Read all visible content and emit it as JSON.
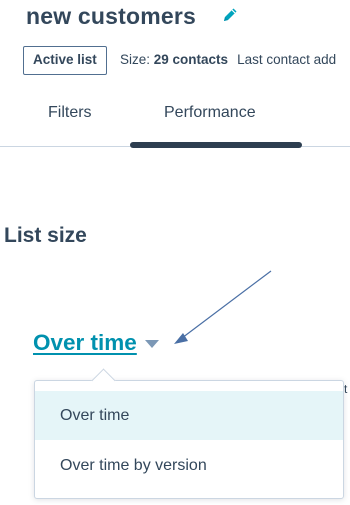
{
  "header": {
    "title": "new customers",
    "edit_icon": "pencil-icon"
  },
  "meta": {
    "status_badge": "Active list",
    "size_label": "Size:",
    "size_value": "29 contacts",
    "last_contact_label": "Last contact add"
  },
  "tabs": [
    {
      "label": "Filters",
      "active": false
    },
    {
      "label": "Performance",
      "active": true
    }
  ],
  "section": {
    "heading": "List size"
  },
  "range_select": {
    "selected": "Over time",
    "caret_icon": "caret-down-icon"
  },
  "dropdown": {
    "options": [
      {
        "label": "Over time",
        "highlighted": true
      },
      {
        "label": "Over time by version",
        "highlighted": false
      }
    ]
  },
  "edge_text": "t",
  "colors": {
    "text": "#33475b",
    "link": "#0091ae",
    "tab_indicator": "#2d3e50",
    "highlight": "#e5f5f8",
    "annotation_arrow": "#4a6fa5"
  }
}
